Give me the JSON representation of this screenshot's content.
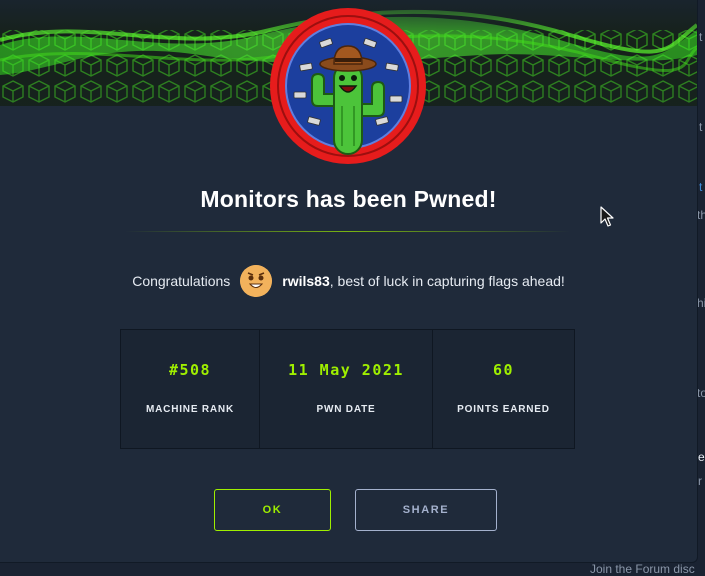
{
  "modal": {
    "title": "Monitors has been Pwned!",
    "congrats_prefix": "Congratulations",
    "username": "rwils83",
    "congrats_suffix": ", best of luck in capturing flags ahead!",
    "stats": [
      {
        "value": "#508",
        "label": "MACHINE RANK"
      },
      {
        "value": "11 May 2021",
        "label": "PWN DATE"
      },
      {
        "value": "60",
        "label": "POINTS EARNED"
      }
    ],
    "buttons": {
      "ok": "OK",
      "share": "SHARE"
    },
    "badge_icon": "cactus-cowboy-badge",
    "avatar_icon": "user-avatar-emoji"
  },
  "colors": {
    "accent_green": "#9fef00",
    "badge_red": "#e61c1c",
    "modal_bg": "#1f2a3a"
  },
  "background_fragments": [
    {
      "text": "t"
    },
    {
      "text": "t"
    },
    {
      "text": "t"
    },
    {
      "text": "th"
    },
    {
      "text": "hi"
    },
    {
      "text": "to"
    },
    {
      "text": "e"
    },
    {
      "text": "r"
    },
    {
      "text": "Join the Forum disc"
    }
  ]
}
